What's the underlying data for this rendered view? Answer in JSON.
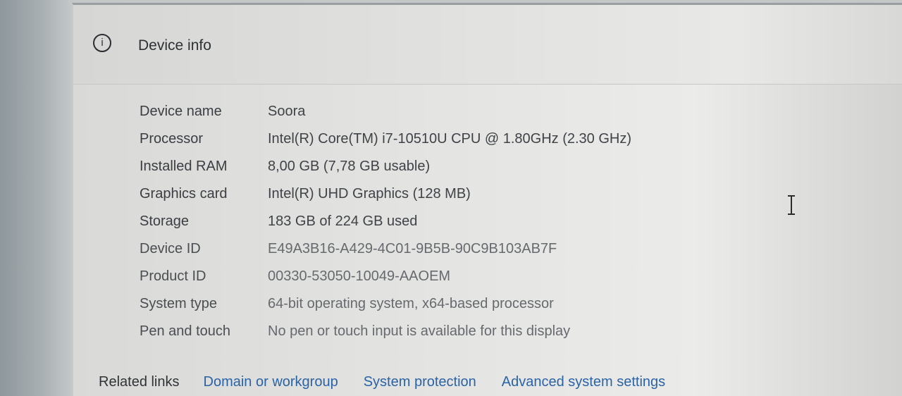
{
  "section": {
    "icon": "info-circle-icon",
    "icon_glyph": "i",
    "title": "Device info"
  },
  "specs": [
    {
      "label": "Device name",
      "value": "Soora"
    },
    {
      "label": "Processor",
      "value": "Intel(R) Core(TM) i7-10510U CPU @ 1.80GHz (2.30 GHz)"
    },
    {
      "label": "Installed RAM",
      "value": "8,00 GB (7,78 GB usable)"
    },
    {
      "label": "Graphics card",
      "value": "Intel(R) UHD Graphics (128 MB)"
    },
    {
      "label": "Storage",
      "value": "183 GB of 224 GB used"
    },
    {
      "label": "Device ID",
      "value": "E49A3B16-A429-4C01-9B5B-90C9B103AB7F"
    },
    {
      "label": "Product ID",
      "value": "00330-53050-10049-AAOEM"
    },
    {
      "label": "System type",
      "value": "64-bit operating system, x64-based processor"
    },
    {
      "label": "Pen and touch",
      "value": "No pen or touch input is available for this display"
    }
  ],
  "related": {
    "title": "Related links",
    "links": [
      {
        "label": "Domain or workgroup"
      },
      {
        "label": "System protection"
      },
      {
        "label": "Advanced system settings"
      }
    ]
  },
  "colors": {
    "link": "#2a63a6",
    "text": "#3a3e42",
    "panel": "#e4e4e2"
  }
}
